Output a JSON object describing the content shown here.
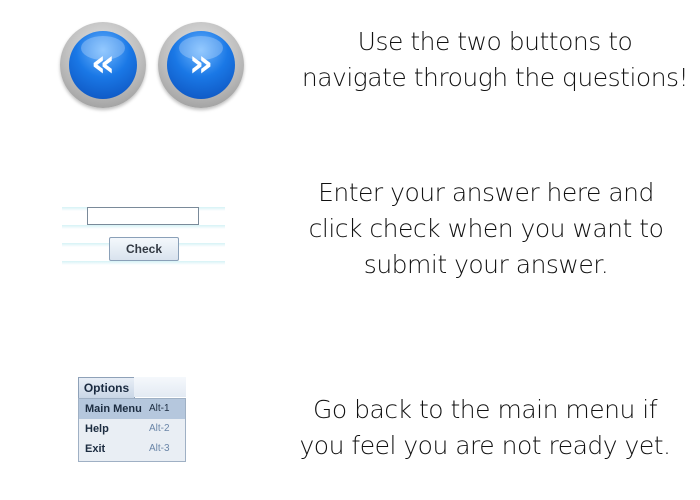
{
  "navigation": {
    "prev_glyph": "«",
    "next_glyph": "»",
    "hint": [
      "Use the two buttons to",
      "navigate through the questions!"
    ]
  },
  "answer": {
    "input_value": "",
    "check_label": "Check",
    "hint": [
      "Enter your answer here and",
      "click check when you want to",
      "submit your answer."
    ]
  },
  "menu": {
    "tab_label": "Options",
    "items": [
      {
        "label": "Main Menu",
        "shortcut": "Alt-1"
      },
      {
        "label": "Help",
        "shortcut": "Alt-2"
      },
      {
        "label": "Exit",
        "shortcut": "Alt-3"
      }
    ],
    "hint": [
      "Go back to the main menu if",
      "you feel you are not ready yet."
    ]
  }
}
